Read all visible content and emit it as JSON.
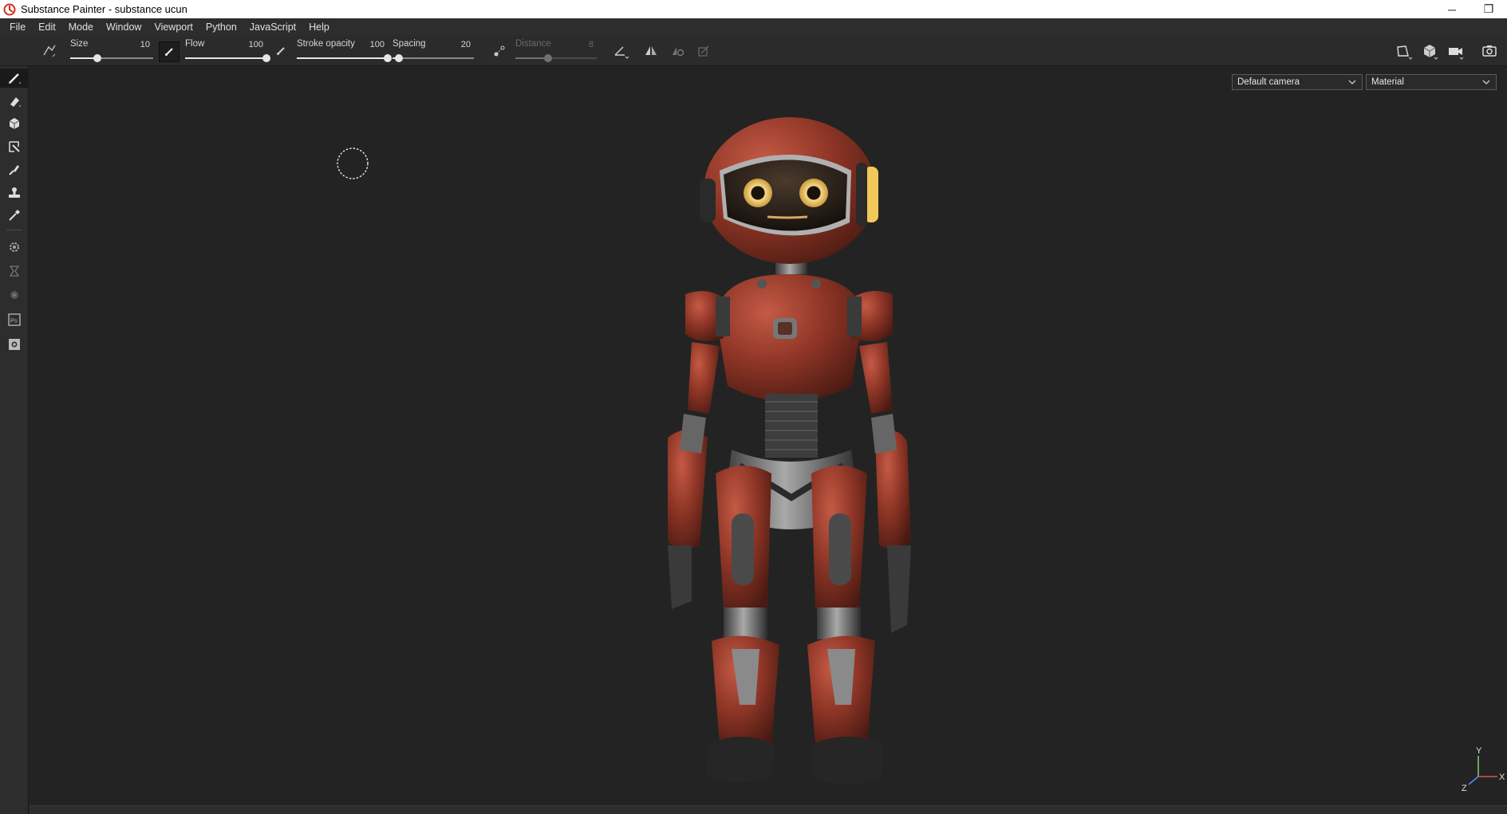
{
  "window": {
    "title": "Substance Painter - substance ucun",
    "minimize": "─",
    "restore": "❐"
  },
  "menu": [
    "File",
    "Edit",
    "Mode",
    "Window",
    "Viewport",
    "Python",
    "JavaScript",
    "Help"
  ],
  "toolbar": {
    "params": [
      {
        "label": "Size",
        "value": "10",
        "level": 0.33
      },
      {
        "label": "Flow",
        "value": "100",
        "level": 1.0
      },
      {
        "label": "Stroke opacity",
        "value": "100",
        "level": 1.0
      },
      {
        "label": "Spacing",
        "value": "20",
        "level": 0.08
      },
      {
        "label": "Distance",
        "value": "8",
        "level": 0.4,
        "disabled": true
      }
    ]
  },
  "viewport": {
    "camera_dropdown": "Default camera",
    "mode_dropdown": "Material",
    "axes": {
      "x": "X",
      "y": "Y",
      "z": "Z"
    }
  },
  "colors": {
    "accent_red": "#c8321e",
    "viewport_bg": "#232323",
    "panel_bg": "#2d2d2d"
  },
  "icons": {
    "left_tools": [
      "brush-icon",
      "eraser-icon",
      "projection-icon",
      "polygon-fill-icon",
      "smudge-icon",
      "clone-icon",
      "color-picker-icon",
      "bake-icon",
      "export-icon",
      "iray-icon",
      "photoshop-icon",
      "screenshot-icon"
    ]
  }
}
